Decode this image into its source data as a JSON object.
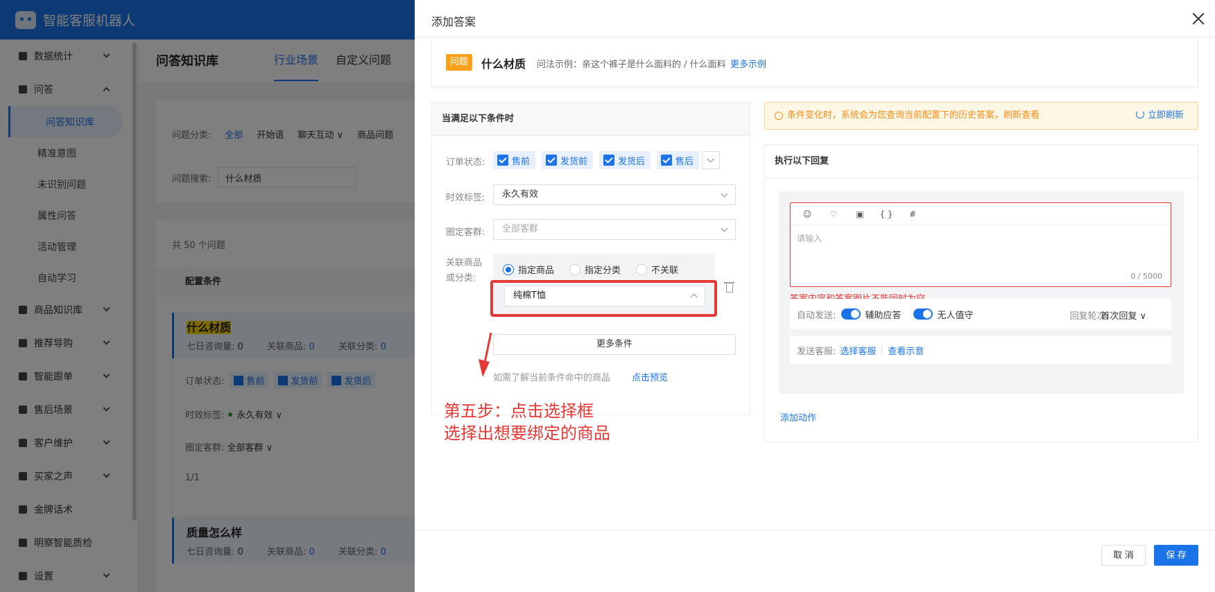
{
  "app": {
    "title": "智能客服机器人"
  },
  "sidebar": {
    "items": [
      {
        "label": "数据统计",
        "icon": "pie-chart-icon"
      },
      {
        "label": "问答",
        "icon": "chat-icon"
      },
      {
        "label": "商品知识库",
        "icon": "book-icon"
      },
      {
        "label": "推荐导购",
        "icon": "gift-icon"
      },
      {
        "label": "智能跟单",
        "icon": "layers-icon"
      },
      {
        "label": "售后场景",
        "icon": "truck-icon"
      },
      {
        "label": "客户维护",
        "icon": "card-icon"
      },
      {
        "label": "买家之声",
        "icon": "voice-icon"
      },
      {
        "label": "金牌话术",
        "icon": "message-icon"
      },
      {
        "label": "明察智能质检",
        "icon": "monitor-icon"
      },
      {
        "label": "设置",
        "icon": "gear-icon"
      }
    ],
    "sub_items": [
      "问答知识库",
      "精准意图",
      "未识别问题",
      "属性问答",
      "活动管理",
      "自动学习"
    ]
  },
  "main": {
    "title": "问答知识库",
    "tabs": [
      "行业场景",
      "自定义问题"
    ],
    "filter": {
      "category_label": "问题分类:",
      "categories": [
        "全部",
        "开始语",
        "聊天互动 ∨",
        "商品问题"
      ],
      "search_label": "问题搜索:",
      "search_value": "什么材质"
    },
    "count": "共 50 个问题",
    "header": "配置条件",
    "questions": [
      {
        "title": "什么材质",
        "views_label": "七日咨询量:",
        "views": "0",
        "goods_label": "关联商品:",
        "goods": "0",
        "cat_label": "关联分类:",
        "cat": "0"
      },
      {
        "title": "质量怎么样",
        "views_label": "七日咨询量:",
        "views": "0",
        "goods_label": "关联商品:",
        "goods": "0",
        "cat_label": "关联分类:",
        "cat": "0"
      }
    ],
    "detail": {
      "order_label": "订单状态:",
      "statuses": [
        "售前",
        "发货前",
        "发货后"
      ],
      "time_label": "时效标签:",
      "time_value": "永久有效 ∨",
      "crowd_label": "圈定客群:",
      "crowd_value": "全部客群 ∨",
      "page": "1/1"
    }
  },
  "drawer": {
    "title": "添加答案",
    "question": {
      "badge": "问题",
      "name": "什么材质",
      "example": "问法示例：亲这个裤子是什么面料的 / 什么面料",
      "more": "更多示例"
    },
    "conditions": {
      "header": "当满足以下条件时",
      "order_label": "订单状态:",
      "statuses": [
        "售前",
        "发货前",
        "发货后",
        "售后"
      ],
      "time_label": "时效标签:",
      "time_value": "永久有效",
      "crowd_label": "圈定客群:",
      "crowd_placeholder": "全部客群",
      "assoc_label_1": "关联商品",
      "assoc_label_2": "或分类:",
      "radios": [
        "指定商品",
        "指定分类",
        "不关联"
      ],
      "selected_radio": "指定商品",
      "product_value": "纯棉T恤",
      "more_button": "更多条件",
      "hint": "如需了解当前条件命中的商品",
      "preview_link": "点击预览"
    },
    "annotation": {
      "line1": "第五步：点击选择框",
      "line2": "选择出想要绑定的商品"
    },
    "notice": {
      "text": "条件变化时，系统会为您查询当前配置下的历史答案，刷新查看",
      "refresh": "立即刷新"
    },
    "reply": {
      "header": "执行以下回复",
      "tools": [
        "☺",
        "♡",
        "▣",
        "{ }",
        "#"
      ],
      "placeholder": "请输入",
      "counter": "0 / 5000",
      "error": "答案内容和答案图片不能同时为空",
      "auto_send_label": "自动发送:",
      "toggle1": "辅助应答",
      "toggle2": "无人值守",
      "round_label": "回复轮次:",
      "round_value": "首次回复 ∨",
      "agent_label": "发送客服:",
      "agent_link": "选择客服",
      "sample_link": "查看示意",
      "add_action": "添加动作"
    },
    "footer": {
      "cancel": "取 消",
      "save": "保 存"
    }
  },
  "colors": {
    "primary": "#1a73e8",
    "danger": "#e53935",
    "warning": "#fa8c16",
    "badge": "#fba21a"
  }
}
